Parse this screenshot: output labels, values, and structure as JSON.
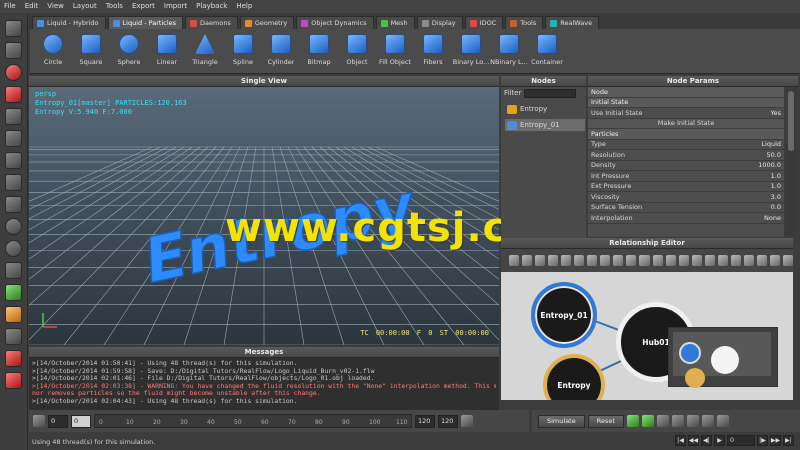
{
  "menu": [
    "File",
    "Edit",
    "View",
    "Layout",
    "Tools",
    "Export",
    "Import",
    "Playback",
    "Help"
  ],
  "tabs": [
    {
      "label": "Liquid - Hybrido",
      "color": "#4a8fd8"
    },
    {
      "label": "Liquid - Particles",
      "color": "#4a8fd8",
      "active": true
    },
    {
      "label": "Daemons",
      "color": "#d84a4a"
    },
    {
      "label": "Geometry",
      "color": "#e0902a"
    },
    {
      "label": "Object Dynamics",
      "color": "#c04ac0"
    },
    {
      "label": "Mesh",
      "color": "#4ac04a"
    },
    {
      "label": "Display",
      "color": "#8a8a8a"
    },
    {
      "label": "IDOC",
      "color": "#d84a4a"
    },
    {
      "label": "Tools",
      "color": "#c0602a"
    },
    {
      "label": "RealWave",
      "color": "#2ab0b0"
    }
  ],
  "tools": [
    {
      "label": "Circle",
      "shape": "round"
    },
    {
      "label": "Square",
      "shape": "square"
    },
    {
      "label": "Sphere",
      "shape": "round"
    },
    {
      "label": "Linear",
      "shape": "square"
    },
    {
      "label": "Triangle",
      "shape": "tri"
    },
    {
      "label": "Spline",
      "shape": "square"
    },
    {
      "label": "Cylinder",
      "shape": "square"
    },
    {
      "label": "Bitmap",
      "shape": "square"
    },
    {
      "label": "Object",
      "shape": "square"
    },
    {
      "label": "Fill Object",
      "shape": "square"
    },
    {
      "label": "Fibers",
      "shape": "square"
    },
    {
      "label": "Binary Lo...",
      "shape": "square"
    },
    {
      "label": "NBinary L...",
      "shape": "square"
    },
    {
      "label": "Container",
      "shape": "square"
    }
  ],
  "viewport": {
    "title": "Single View",
    "camera": "persp",
    "info1": "Entropy_01[master] PARTICLES:120,163",
    "info2": "Entropy V:5.940 F:7.000",
    "timecode": "TC 00:00:00   F 0   ST 00:00:00",
    "scene_text": "Entropy",
    "watermark": "www.cgtsj.com"
  },
  "nodes": {
    "title": "Nodes",
    "filter_label": "Filter",
    "items": [
      "Entropy",
      "Entropy_01"
    ]
  },
  "params": {
    "title": "Node Params",
    "rows": [
      {
        "type": "sect",
        "label": "Node"
      },
      {
        "type": "sect",
        "label": "Initial State"
      },
      {
        "type": "row",
        "label": "Use Initial State",
        "value": "Yes"
      },
      {
        "type": "btn",
        "label": "Make Initial State"
      },
      {
        "type": "sect",
        "label": "Particles"
      },
      {
        "type": "row",
        "label": "Type",
        "value": "Liquid"
      },
      {
        "type": "row",
        "label": "Resolution",
        "value": "50.0"
      },
      {
        "type": "row",
        "label": "Density",
        "value": "1000.0"
      },
      {
        "type": "row",
        "label": "Int Pressure",
        "value": "1.0"
      },
      {
        "type": "row",
        "label": "Ext Pressure",
        "value": "1.0"
      },
      {
        "type": "row",
        "label": "Viscosity",
        "value": "3.0"
      },
      {
        "type": "row",
        "label": "Surface Tension",
        "value": "0.0"
      },
      {
        "type": "row",
        "label": "Interpolation",
        "value": "None"
      }
    ]
  },
  "relationship": {
    "title": "Relationship Editor",
    "node_a": "Entropy_01",
    "node_b": "Hub01",
    "node_c": "Entropy"
  },
  "messages": {
    "title": "Messages",
    "lines": [
      {
        "kind": "normal",
        "text": ">[14/October/2014 01:50:41] - Using 48 thread(s) for this simulation."
      },
      {
        "kind": "normal",
        "text": ">[14/October/2014 01:59:58] - Save: D:/Digital Tutors/RealFlow/Logo_Liquid_Burn_v02-1.flw"
      },
      {
        "kind": "normal",
        "text": ">[14/October/2014 02:01:46] - File D:/Digital Tutors/RealFlow/objects/Logo_01.obj loaded."
      },
      {
        "kind": "warn",
        "text": ">[14/October/2014 02:03:38] - WARNING: You have changed the fluid resolution  with the \"None\" interpolation method. This method  neither creates"
      },
      {
        "kind": "warn",
        "text": "nor removes particles so the  fluid might become unstable after this change."
      },
      {
        "kind": "normal",
        "text": ">[14/October/2014 02:04:43] - Using 48 thread(s) for this simulation."
      }
    ]
  },
  "timeline": {
    "start": "0",
    "current": "0",
    "ticks": [
      "0",
      "10",
      "20",
      "30",
      "40",
      "50",
      "60",
      "70",
      "80",
      "90",
      "100",
      "110"
    ],
    "end1": "120",
    "end2": "120"
  },
  "sim": {
    "simulate": "Simulate",
    "reset": "Reset"
  },
  "status": {
    "text": "Using 48 thread(s) for this simulation.",
    "frame": "0"
  }
}
